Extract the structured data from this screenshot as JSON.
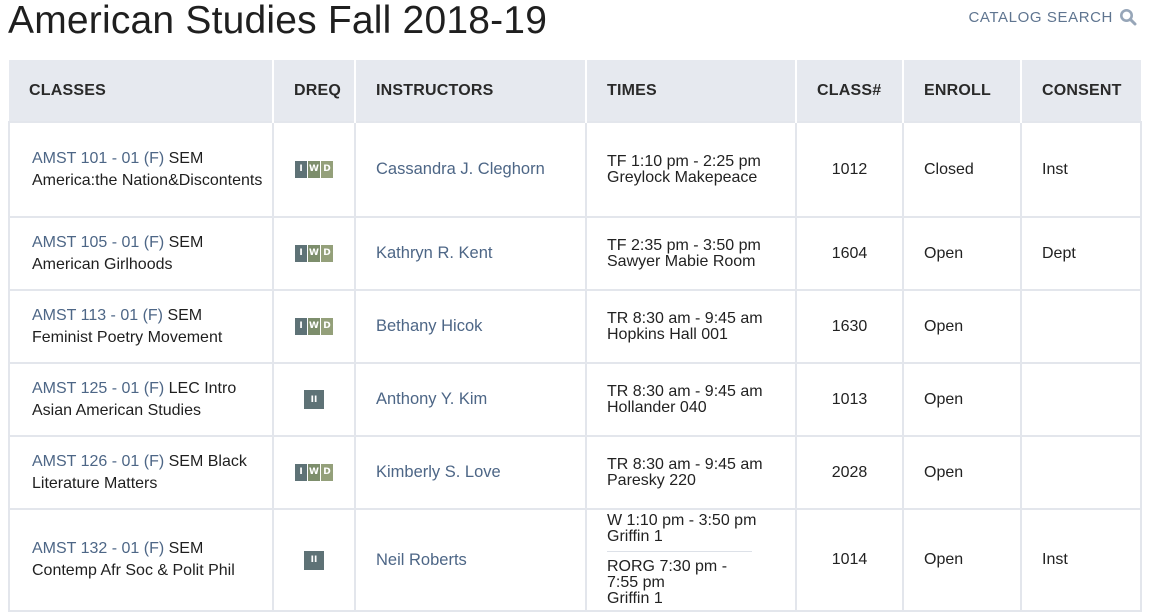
{
  "page": {
    "title": "American Studies Fall 2018-19",
    "catalog_search_label": "CATALOG SEARCH"
  },
  "table": {
    "headers": [
      "CLASSES",
      "DREQ",
      "INSTRUCTORS",
      "TIMES",
      "CLASS#",
      "ENROLL",
      "CONSENT"
    ],
    "rows": [
      {
        "course": "AMST 101 - 01 (F)",
        "type": " SEM",
        "title": "America:the Nation&Discontents",
        "dreq": [
          "I",
          "W",
          "D"
        ],
        "dreq_style": "iwd",
        "instructor": "Cassandra J. Cleghorn",
        "times": [
          {
            "time": "TF 1:10 pm - 2:25 pm",
            "place": "Greylock Makepeace"
          }
        ],
        "class_num": "1012",
        "enroll": "Closed",
        "consent": "Inst"
      },
      {
        "course": "AMST 105 - 01 (F)",
        "type": " SEM",
        "title": "American Girlhoods",
        "dreq": [
          "I",
          "W",
          "D"
        ],
        "dreq_style": "iwd",
        "instructor": "Kathryn R. Kent",
        "times": [
          {
            "time": "TF 2:35 pm - 3:50 pm",
            "place": "Sawyer Mabie Room"
          }
        ],
        "class_num": "1604",
        "enroll": "Open",
        "consent": "Dept"
      },
      {
        "course": "AMST 113 - 01 (F)",
        "type": " SEM",
        "title": "Feminist Poetry Movement",
        "dreq": [
          "I",
          "W",
          "D"
        ],
        "dreq_style": "iwd",
        "instructor": "Bethany Hicok",
        "times": [
          {
            "time": "TR 8:30 am - 9:45 am",
            "place": "Hopkins Hall 001"
          }
        ],
        "class_num": "1630",
        "enroll": "Open",
        "consent": ""
      },
      {
        "course": "AMST 125 - 01 (F)",
        "type": " LEC Intro",
        "title": "Asian American Studies",
        "dreq": [
          "II"
        ],
        "dreq_style": "ii",
        "instructor": "Anthony Y. Kim",
        "times": [
          {
            "time": "TR 8:30 am - 9:45 am",
            "place": "Hollander 040"
          }
        ],
        "class_num": "1013",
        "enroll": "Open",
        "consent": ""
      },
      {
        "course": "AMST 126 - 01 (F)",
        "type": " SEM Black",
        "title": "Literature Matters",
        "dreq": [
          "I",
          "W",
          "D"
        ],
        "dreq_style": "iwd",
        "instructor": "Kimberly S. Love",
        "times": [
          {
            "time": "TR 8:30 am - 9:45 am",
            "place": "Paresky 220"
          }
        ],
        "class_num": "2028",
        "enroll": "Open",
        "consent": ""
      },
      {
        "course": "AMST 132 - 01 (F)",
        "type": " SEM",
        "title": "Contemp Afr Soc & Polit Phil",
        "dreq": [
          "II"
        ],
        "dreq_style": "ii",
        "instructor": "Neil Roberts",
        "times": [
          {
            "time": "W 1:10 pm - 3:50 pm",
            "place": "Griffin 1"
          },
          {
            "time": "RORG 7:30 pm - 7:55 pm",
            "place": "Griffin 1"
          }
        ],
        "class_num": "1014",
        "enroll": "Open",
        "consent": "Inst"
      }
    ]
  },
  "icons": {
    "catalog_search": "search-icon"
  },
  "colors": {
    "link": "#4d6686",
    "header_bg": "#e6e9ef",
    "badge_i": "#5e7276",
    "badge_w": "#7d8e6c",
    "badge_d": "#94a07a"
  }
}
